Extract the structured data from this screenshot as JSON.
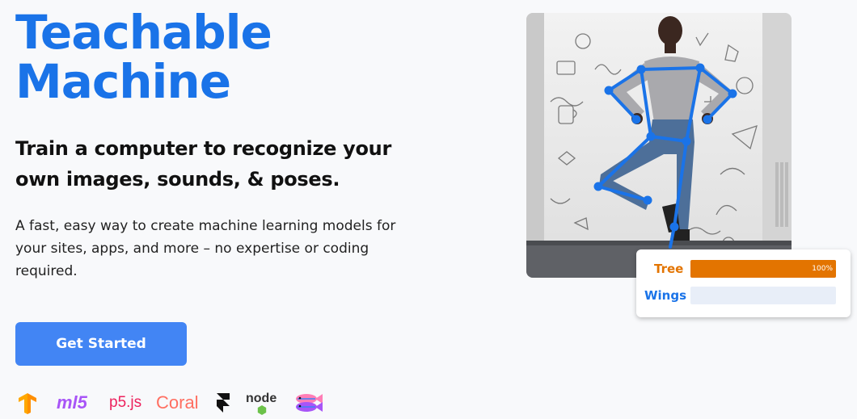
{
  "hero": {
    "title_line1": "Teachable",
    "title_line2": "Machine",
    "subtitle": "Train a computer to recognize your own images, sounds, & poses.",
    "description": "A fast, easy way to create machine learning models for your sites, apps, and more – no expertise or coding required.",
    "cta_label": "Get Started"
  },
  "colors": {
    "brand_blue": "#1a73e8",
    "button_blue": "#4285f4",
    "tree_orange": "#e37400",
    "wings_blue": "#1a73e8"
  },
  "logos": {
    "tensorflow": {
      "icon": "tensorflow-logo"
    },
    "ml5": {
      "text": "ml5"
    },
    "p5js": {
      "text": "p5.js"
    },
    "coral": {
      "text": "Coral"
    },
    "framer": {
      "icon": "framer-logo"
    },
    "node": {
      "text": "node"
    },
    "glitch": {
      "icon": "glitch-fish-logo"
    }
  },
  "pose_demo": {
    "image": "person-tree-pose-photo",
    "classes": [
      {
        "label": "Tree",
        "confidence": 1.0,
        "percent_label": "100%",
        "color": "#e37400"
      },
      {
        "label": "Wings",
        "confidence": 0.0,
        "percent_label": "",
        "color": "#1a73e8"
      }
    ]
  }
}
